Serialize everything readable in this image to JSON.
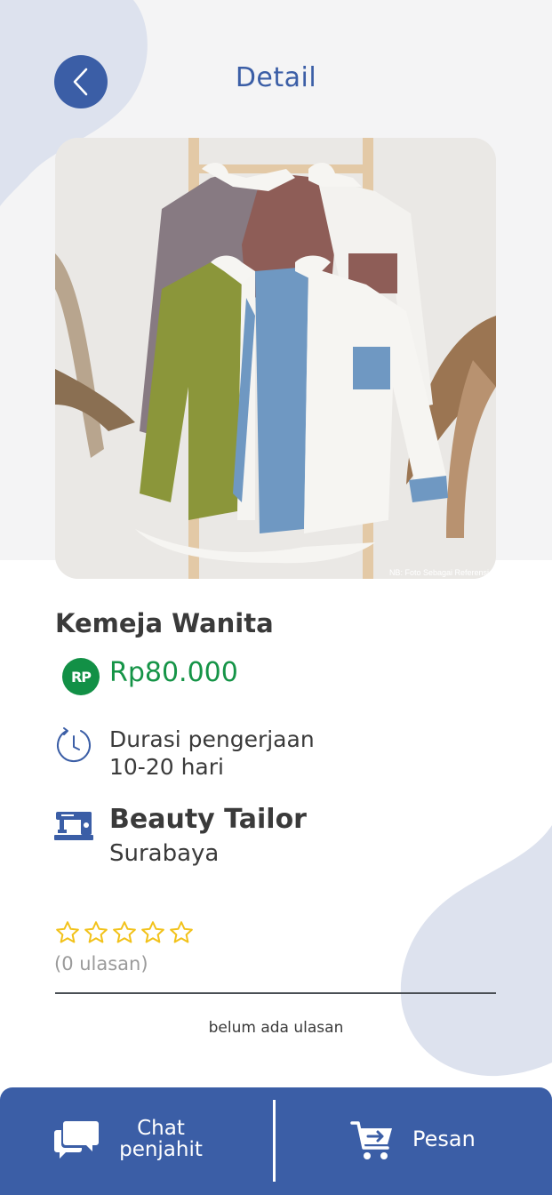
{
  "header": {
    "title": "Detail"
  },
  "product": {
    "name": "Kemeja Wanita",
    "currency_badge": "RP",
    "price": "Rp80.000",
    "photo_caption": "NB: Foto Sebagai Referensi",
    "duration_label": "Durasi pengerjaan",
    "duration_value": "10-20 hari"
  },
  "tailor": {
    "name": "Beauty Tailor",
    "city": "Surabaya"
  },
  "reviews": {
    "rating": 0,
    "max_rating": 5,
    "count_text": "(0 ulasan)",
    "empty_text": "belum ada ulasan"
  },
  "actions": {
    "chat_line1": "Chat",
    "chat_line2": "penjahit",
    "order_label": "Pesan"
  },
  "icons": {
    "back": "chevron-left-icon",
    "duration": "clock-refresh-icon",
    "tailor": "sewing-machine-icon",
    "star": "star-outline-icon",
    "chat": "chat-bubbles-icon",
    "cart": "cart-arrow-icon"
  },
  "colors": {
    "primary": "#3b5ea6",
    "price_green": "#159447",
    "star": "#f2c21a",
    "blob": "#dde2ee"
  }
}
